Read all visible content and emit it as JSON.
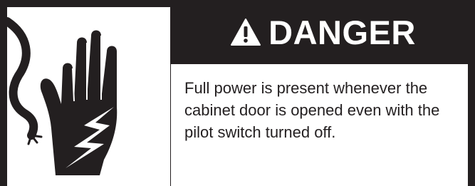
{
  "label": {
    "signal_word": "DANGER",
    "message": "Full power is present whenever the cabinet door is opened even with the pilot switch turned off.",
    "colors": {
      "dark": "#231f20",
      "light": "#ffffff"
    },
    "icons": {
      "alert": "warning-triangle-icon",
      "pictogram": "electric-shock-hand-icon"
    }
  }
}
